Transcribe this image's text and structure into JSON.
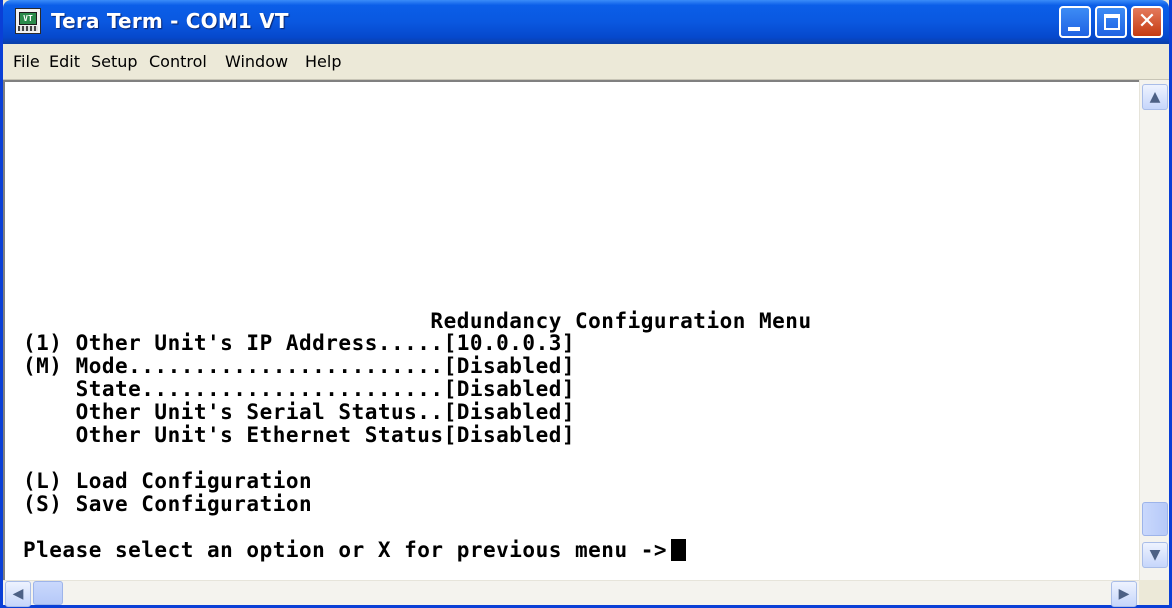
{
  "window": {
    "title": "Tera Term - COM1 VT",
    "app_icon_text": "VT"
  },
  "menubar": {
    "items": [
      "File",
      "Edit",
      "Setup",
      "Control",
      "Window",
      "Help"
    ]
  },
  "terminal": {
    "lines": [
      "                               Redundancy Configuration Menu",
      "(1) Other Unit's IP Address.....[10.0.0.3]",
      "(M) Mode........................[Disabled]",
      "    State.......................[Disabled]",
      "    Other Unit's Serial Status..[Disabled]",
      "    Other Unit's Ethernet Status[Disabled]",
      "",
      "(L) Load Configuration",
      "(S) Save Configuration",
      "",
      "Please select an option or X for previous menu ->"
    ]
  },
  "scrollbars": {
    "up_glyph": "▲",
    "down_glyph": "▼",
    "left_glyph": "◀",
    "right_glyph": "▶"
  },
  "titlebar_buttons": {
    "close_glyph": "✕"
  }
}
